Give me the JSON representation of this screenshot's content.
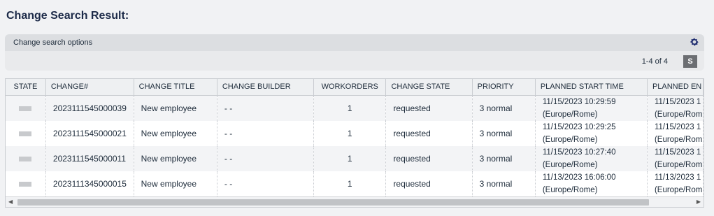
{
  "page": {
    "title": "Change Search Result:"
  },
  "options": {
    "label": "Change search options",
    "settings_icon": "gear-icon"
  },
  "pager": {
    "range": "1-4 of 4",
    "s_button": "S"
  },
  "table": {
    "columns": [
      "STATE",
      "CHANGE#",
      "CHANGE TITLE",
      "CHANGE BUILDER",
      "WORKORDERS",
      "CHANGE STATE",
      "PRIORITY",
      "PLANNED START TIME",
      "PLANNED EN"
    ],
    "rows": [
      {
        "change": "2023111545000039",
        "title": "New employee",
        "builder": "- -",
        "workorders": "1",
        "state": "requested",
        "priority": "3 normal",
        "start_time": "11/15/2023 10:29:59",
        "start_tz": "(Europe/Rome)",
        "end_time": "11/15/2023 1",
        "end_tz": "(Europe/Rom"
      },
      {
        "change": "2023111545000021",
        "title": "New employee",
        "builder": "- -",
        "workorders": "1",
        "state": "requested",
        "priority": "3 normal",
        "start_time": "11/15/2023 10:29:25",
        "start_tz": "(Europe/Rome)",
        "end_time": "11/15/2023 1",
        "end_tz": "(Europe/Rom"
      },
      {
        "change": "2023111545000011",
        "title": "New employee",
        "builder": "- -",
        "workorders": "1",
        "state": "requested",
        "priority": "3 normal",
        "start_time": "11/15/2023 10:27:40",
        "start_tz": "(Europe/Rome)",
        "end_time": "11/15/2023 1",
        "end_tz": "(Europe/Rom"
      },
      {
        "change": "2023111345000015",
        "title": "New employee",
        "builder": "- -",
        "workorders": "1",
        "state": "requested",
        "priority": "3 normal",
        "start_time": "11/13/2023 16:06:00",
        "start_tz": "(Europe/Rome)",
        "end_time": "11/13/2023 1",
        "end_tz": "(Europe/Rom"
      }
    ]
  },
  "colors": {
    "title": "#1c2a48",
    "header_bg": "#dcdee1",
    "s_button_bg": "#6c6e72"
  }
}
